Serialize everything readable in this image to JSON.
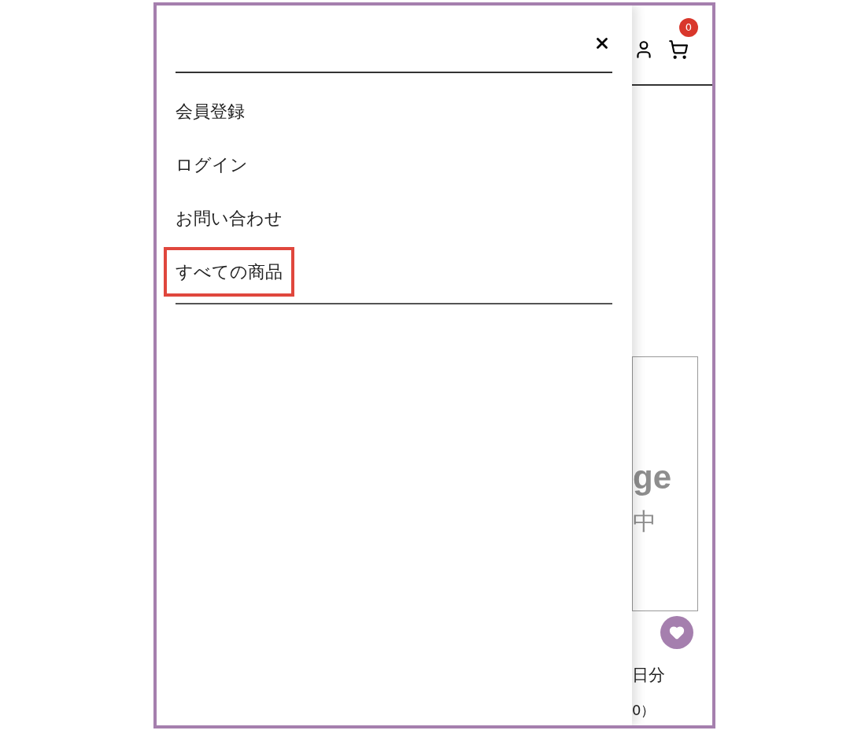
{
  "drawer": {
    "menu_items": [
      {
        "label": "会員登録",
        "highlighted": false
      },
      {
        "label": "ログイン",
        "highlighted": false
      },
      {
        "label": "お問い合わせ",
        "highlighted": false
      },
      {
        "label": "すべての商品",
        "highlighted": true
      }
    ]
  },
  "header": {
    "cart_count": "0"
  },
  "background_page": {
    "image_texts": [
      "ge",
      "中"
    ],
    "texts": [
      "日分",
      "0）"
    ]
  }
}
